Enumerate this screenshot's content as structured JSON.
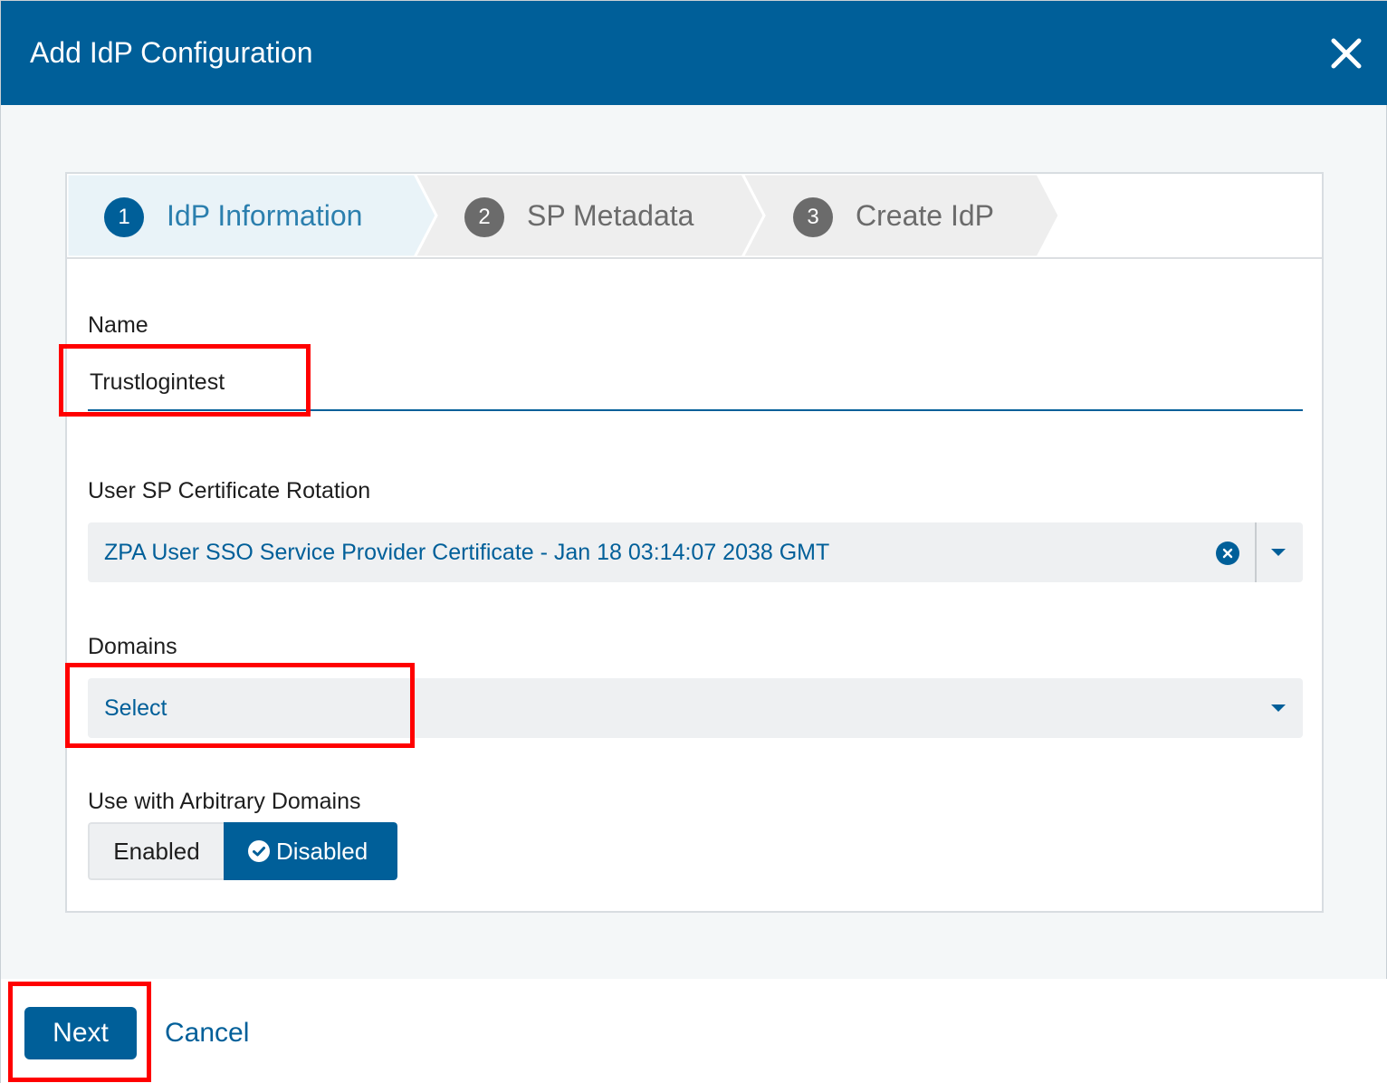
{
  "dialog": {
    "title": "Add IdP Configuration"
  },
  "steps": [
    {
      "number": "1",
      "label": "IdP Information",
      "active": true
    },
    {
      "number": "2",
      "label": "SP Metadata",
      "active": false
    },
    {
      "number": "3",
      "label": "Create IdP",
      "active": false
    }
  ],
  "form": {
    "name_label": "Name",
    "name_value": "Trustlogintest",
    "cert_label": "User SP Certificate Rotation",
    "cert_value": "ZPA User SSO Service Provider Certificate - Jan 18 03:14:07 2038 GMT",
    "domains_label": "Domains",
    "domains_placeholder": "Select",
    "arbitrary_label": "Use with Arbitrary Domains",
    "toggle": {
      "enabled_label": "Enabled",
      "disabled_label": "Disabled",
      "selected": "Disabled"
    }
  },
  "footer": {
    "next_label": "Next",
    "cancel_label": "Cancel"
  },
  "colors": {
    "brand": "#005f99",
    "highlight": "#ff0000",
    "active_step_bg": "#e9f3f8",
    "inactive_step_bg": "#eeeeee"
  },
  "icons": [
    "close-icon",
    "clear-icon",
    "chevron-down-icon",
    "check-circle-icon"
  ]
}
